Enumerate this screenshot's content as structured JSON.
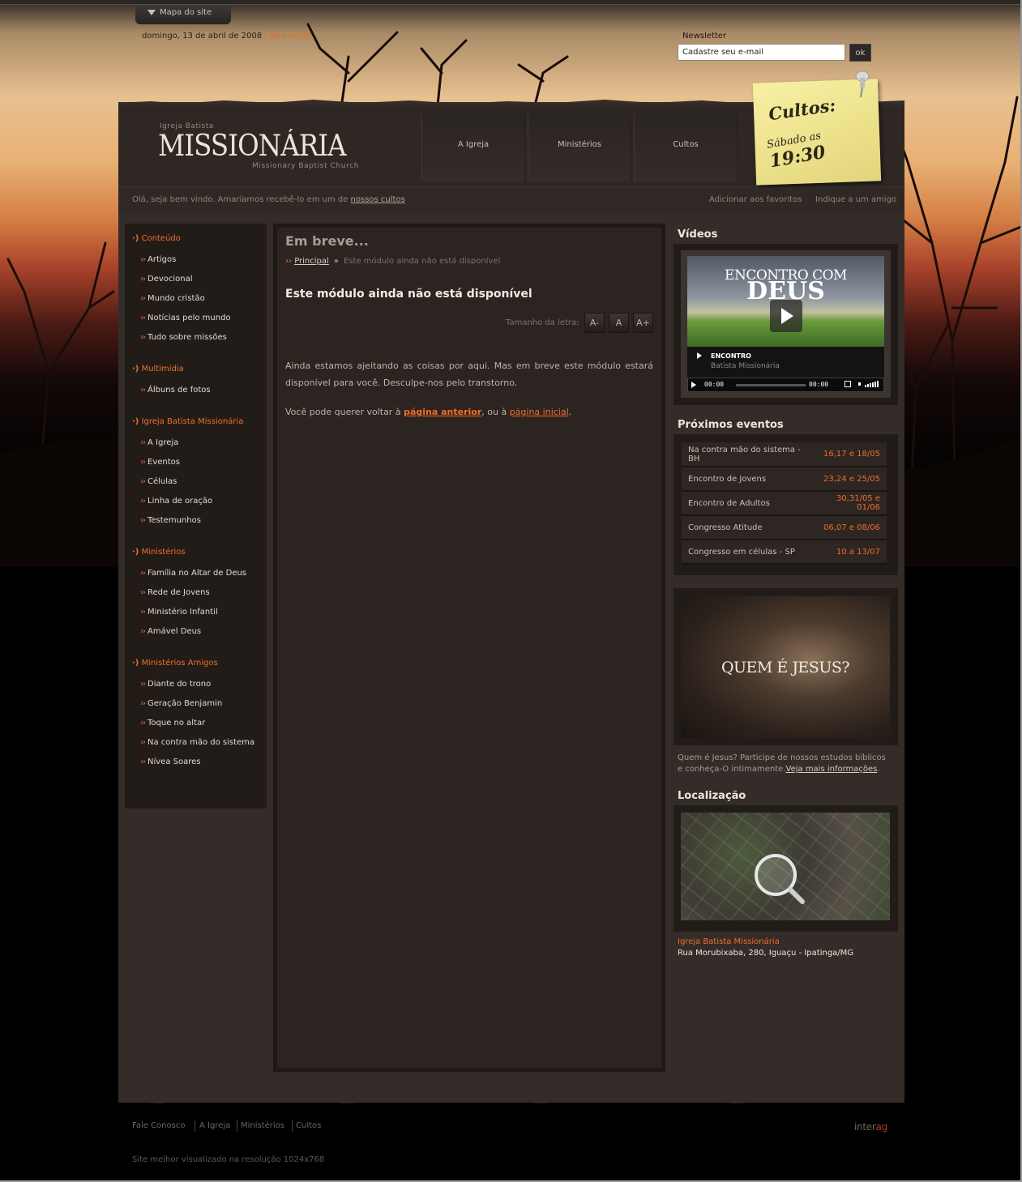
{
  "top": {
    "sitemap_label": "Mapa do site",
    "date": "domingo, 13 de abril de 2008",
    "greeting": " - Boa noite!",
    "newsletter_label": "Newsletter",
    "newsletter_value": "Cadastre seu e-mail",
    "newsletter_button": "ok"
  },
  "logo": {
    "top": "Igreja Batista",
    "main": "MISSIONÁRIA",
    "sub": "Missionary Baptist Church"
  },
  "nav": [
    "A Igreja",
    "Ministérios",
    "Cultos"
  ],
  "note": {
    "title": "Cultos:",
    "day": "Sábado as",
    "time": "19:30"
  },
  "welcome": {
    "text": "Olá, seja bem vindo. Amaríamos recebê-lo em um de ",
    "link": "nossos cultos",
    "favorites": "Adicionar aos favoritos",
    "recommend": "Indique a um amigo"
  },
  "sidebar": [
    {
      "title": "Conteúdo",
      "items": [
        "Artigos",
        "Devocional",
        "Mundo cristão",
        "Notícias pelo mundo",
        "Tudo sobre missões"
      ]
    },
    {
      "title": "Multimídia",
      "items": [
        "Álbuns de fotos"
      ]
    },
    {
      "title": "Igreja Batista Missionária",
      "items": [
        "A Igreja",
        "Eventos",
        "Células",
        "Linha de oração",
        "Testemunhos"
      ]
    },
    {
      "title": "Ministérios",
      "items": [
        "Família no Altar de Deus",
        "Rede de Jovens",
        "Ministério Infantil",
        "Amável Deus"
      ]
    },
    {
      "title": "Ministérios Amigos",
      "items": [
        "Diante do trono",
        "Geração Benjamin",
        "Toque no altar",
        "Na contra mão do sistema",
        "Nívea Soares"
      ]
    }
  ],
  "content": {
    "title": "Em breve...",
    "breadcrumb_home": "Principal",
    "breadcrumb_current": "Este módulo ainda não está disponível",
    "article_title": "Este módulo ainda não está disponível",
    "fontsize_label": "Tamanho da letra:",
    "fontsize_buttons": [
      "A-",
      "A",
      "A+"
    ],
    "para1": "Ainda estamos ajeitando as coisas por aqui. Mas em breve este módulo estará disponível para você. Desculpe-nos pelo transtorno.",
    "para2_a": "Você pode querer voltar à ",
    "para2_link1": "página anterior",
    "para2_b": ", ou à ",
    "para2_link2": "página inicial",
    "para2_c": "."
  },
  "videos": {
    "heading": "Vídeos",
    "screen_line1": "ENCONTRO COM",
    "screen_line2": "DEUS",
    "caption_title": "ENCONTRO",
    "caption_sub": "Batista Missionária",
    "time_current": "00:00",
    "time_total": "00:00"
  },
  "events": {
    "heading": "Próximos eventos",
    "rows": [
      {
        "name": "Na contra mão do sistema - BH",
        "date": "16,17 e 18/05"
      },
      {
        "name": "Encontro de Jovens",
        "date": "23,24 e 25/05"
      },
      {
        "name": "Encontro de Adultos",
        "date": "30,31/05 e 01/06"
      },
      {
        "name": "Congresso Atitude",
        "date": "06,07 e 08/06"
      },
      {
        "name": "Congresso em células - SP",
        "date": "10 a 13/07"
      }
    ]
  },
  "jesus": {
    "image_text": "QUEM É JESUS?",
    "text": "Quem é Jesus? Participe de nossos estudos bíblicos e conheça-O intimamente.",
    "link": "Veja mais informações",
    "tail": "."
  },
  "location": {
    "heading": "Localização",
    "name": "Igreja Batista Missionária",
    "address": "Rua Morubixaba, 280, Iguaçu - Ipatinga/MG"
  },
  "footer": {
    "links": [
      "Fale Conosco",
      "A Igreja",
      "Ministérios",
      "Cultos"
    ],
    "note": "Site melhor visualizado na resolução 1024x768",
    "brand_a": "inter",
    "brand_b": "ag"
  }
}
